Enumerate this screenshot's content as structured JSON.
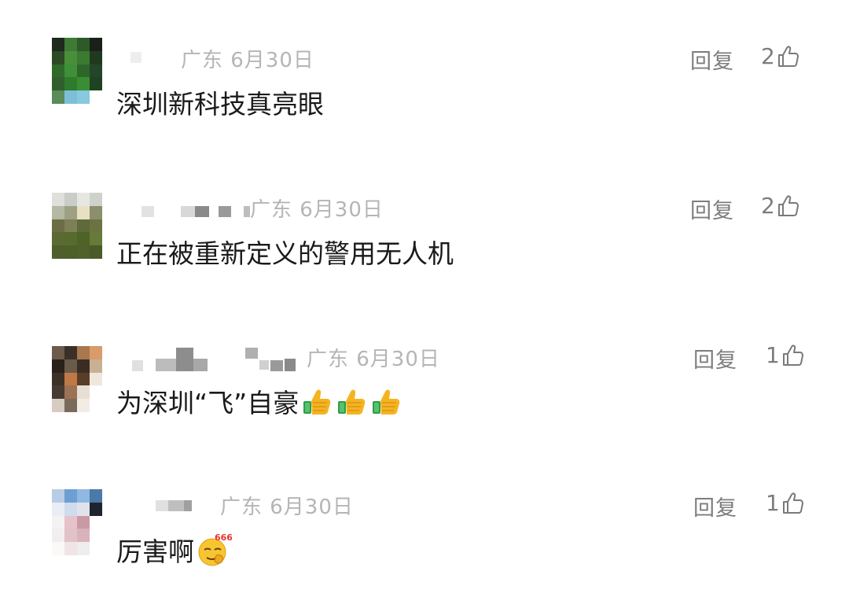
{
  "comments": [
    {
      "location_date": "广东 6月30日",
      "reply_label": "回复",
      "likes": "2",
      "text": "深圳新科技真亮眼",
      "avatar_colors": [
        "#1d2a1c",
        "#3f7a35",
        "#2d5a28",
        "#1a2019",
        "#2b4a25",
        "#4a8e3a",
        "#3a7a31",
        "#1f3a1e",
        "#2f6a2a",
        "#3e8f37",
        "#2d6628",
        "#24452a",
        "#315f2c",
        "#2e7b2c",
        "#3b8d34",
        "#1f4221",
        "#5a8b5a",
        "#7cc0d8",
        "#87c9de",
        "#ffffff"
      ]
    },
    {
      "location_date": "广东 6月30日",
      "reply_label": "回复",
      "likes": "2",
      "text": "正在被重新定义的警用无人机",
      "avatar_colors": [
        "#dfe0dc",
        "#c9ccc8",
        "#e6e7e2",
        "#cfd1cb",
        "#b5b8a3",
        "#9ea084",
        "#e8e0c3",
        "#8c8f6d",
        "#6b6e44",
        "#7f7f56",
        "#5e6a3a",
        "#6b7340",
        "#5b6a31",
        "#576b2e",
        "#4f6329",
        "#687a3a",
        "#4f5f2b",
        "#4d5f2a",
        "#50612c",
        "#4a5a28"
      ]
    },
    {
      "location_date": "广东 6月30日",
      "reply_label": "回复",
      "likes": "1",
      "text": "为深圳“飞”自豪",
      "avatar_colors": [
        "#6c5a4a",
        "#3b3028",
        "#a9794d",
        "#d89b6b",
        "#2a201a",
        "#6a5a49",
        "#3a2c24",
        "#c8b094",
        "#3d3027",
        "#c07944",
        "#5a3d28",
        "#f0e7dc",
        "#473a30",
        "#9b7253",
        "#e8dfd4",
        "#ffffff",
        "#d6ccc1",
        "#7a6a5c",
        "#f2ece5",
        "#ffffff"
      ]
    },
    {
      "location_date": "广东 6月30日",
      "reply_label": "回复",
      "likes": "1",
      "text": "厉害啊",
      "avatar_colors": [
        "#b7cde6",
        "#6e9fd4",
        "#91b8e2",
        "#4b79a8",
        "#e9eef5",
        "#cfdced",
        "#e0e3ea",
        "#1f2330",
        "#f5f2f3",
        "#e6c3cb",
        "#c99aa6",
        "#ffffff",
        "#f2eeef",
        "#e2c1c8",
        "#d8b3bb",
        "#ffffff",
        "#fbf8f8",
        "#f1e4e6",
        "#eeeeee",
        "#ffffff"
      ]
    }
  ]
}
